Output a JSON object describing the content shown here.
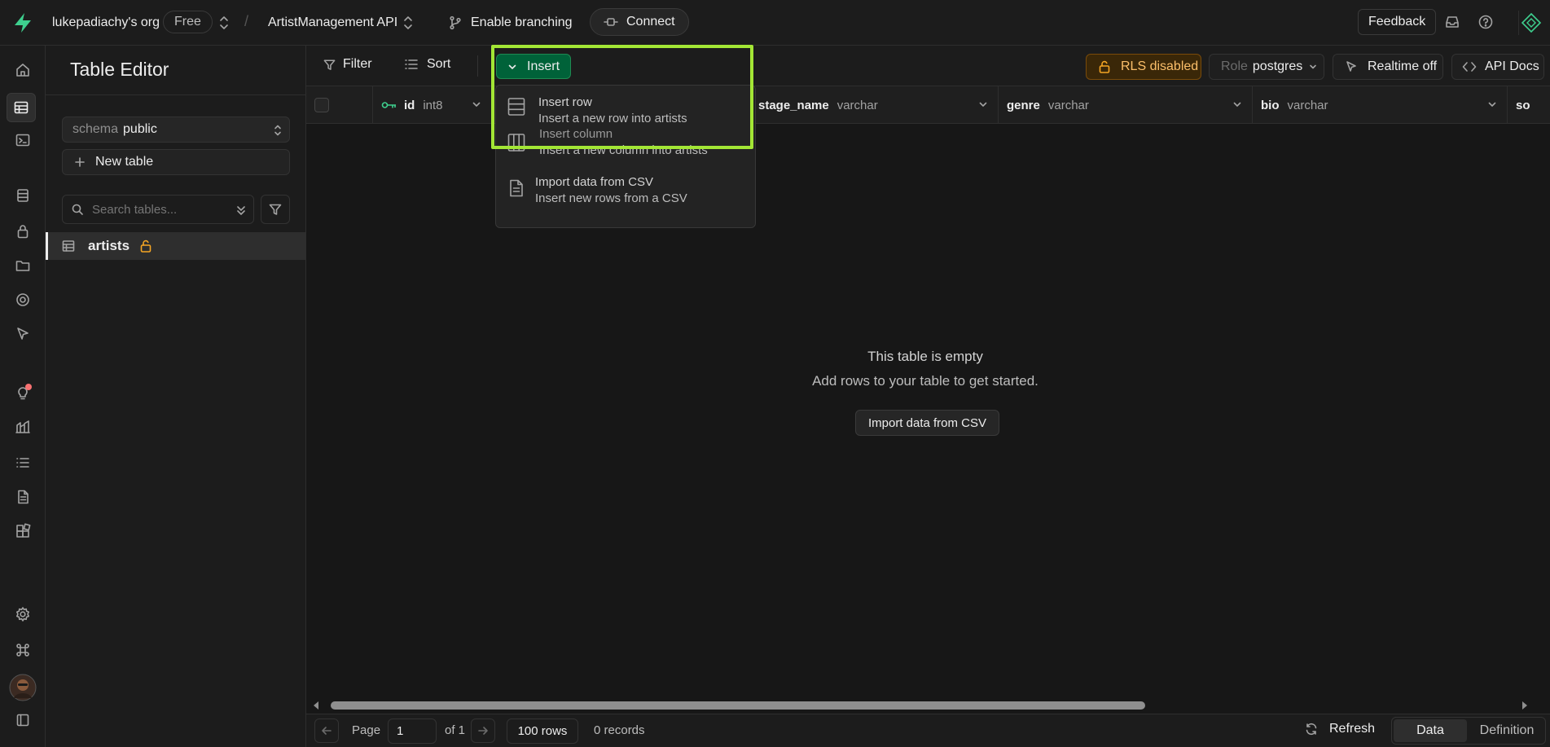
{
  "topbar": {
    "org_name": "lukepadiachy's org",
    "plan_badge": "Free",
    "separator": "/",
    "project_name": "ArtistManagement API",
    "branching_label": "Enable branching",
    "connect_label": "Connect",
    "feedback_label": "Feedback"
  },
  "sidebar": {
    "title": "Table Editor",
    "schema_label": "schema",
    "schema_value": "public",
    "new_table_label": "New table",
    "search_placeholder": "Search tables...",
    "tables": [
      {
        "name": "artists"
      }
    ]
  },
  "toolbar": {
    "filter_label": "Filter",
    "sort_label": "Sort",
    "insert_label": "Insert",
    "rls_label": "RLS disabled",
    "role_label": "Role",
    "role_value": "postgres",
    "realtime_label": "Realtime off",
    "api_docs_label": "API Docs"
  },
  "columns": [
    {
      "name": "id",
      "type": "int8"
    },
    {
      "name": "stage_name",
      "type": "varchar"
    },
    {
      "name": "genre",
      "type": "varchar"
    },
    {
      "name": "bio",
      "type": "varchar"
    },
    {
      "name": "so",
      "type": ""
    }
  ],
  "insert_menu": [
    {
      "title": "Insert row",
      "subtitle": "Insert a new row into artists"
    },
    {
      "title": "Insert column",
      "subtitle": "Insert a new column into artists"
    },
    {
      "title": "Import data from CSV",
      "subtitle": "Insert new rows from a CSV"
    }
  ],
  "empty_state": {
    "title": "This table is empty",
    "subtitle": "Add rows to your table to get started.",
    "button_label": "Import data from CSV"
  },
  "footer": {
    "page_label": "Page",
    "page_value": "1",
    "of_label": "of 1",
    "rows_label": "100 rows",
    "records_label": "0 records",
    "refresh_label": "Refresh",
    "data_tab": "Data",
    "definition_tab": "Definition"
  },
  "colors": {
    "brand_green": "#3ecf8e",
    "insert_green": "#006239",
    "highlight": "#a3e635",
    "rls_orange": "#f5a524"
  }
}
